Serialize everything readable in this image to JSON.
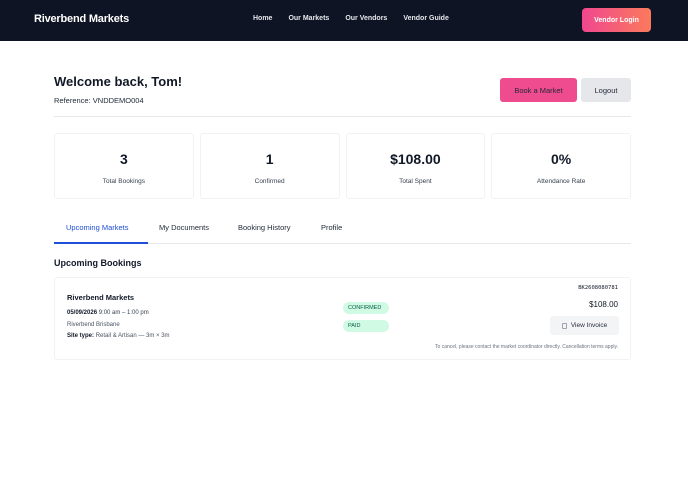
{
  "nav": {
    "brand": "Riverbend Markets",
    "links": [
      "Home",
      "Our Markets",
      "Our Vendors",
      "Vendor Guide"
    ],
    "cta": "Vendor Login"
  },
  "header": {
    "welcome": "Welcome back, Tom!",
    "reference": "Reference: VNDDEMO004",
    "book_label": "Book a Market",
    "logout_label": "Logout"
  },
  "stats": [
    {
      "value": "3",
      "label": "Total Bookings"
    },
    {
      "value": "1",
      "label": "Confirmed"
    },
    {
      "value": "$108.00",
      "label": "Total Spent"
    },
    {
      "value": "0%",
      "label": "Attendance Rate"
    }
  ],
  "tabs": [
    "Upcoming Markets",
    "My Documents",
    "Booking History",
    "Profile"
  ],
  "active_tab": "Upcoming Markets",
  "section_title": "Upcoming Bookings",
  "booking": {
    "market": "Riverbend Markets",
    "date": "05/09/2026",
    "time": "9:00 am – 1:00 pm",
    "location": "Riverbend Brisbane",
    "site_type_label": "Site type:",
    "site_type_value": "Retail & Artisan — 3m × 3m",
    "status_confirmed": "CONFIRMED",
    "status_paid": "PAID",
    "ref": "BK2608080781",
    "amount": "$108.00",
    "invoice_label": "View Invoice",
    "note": "To cancel, please contact the market coordinator directly. Cancellation terms apply."
  },
  "colors": {
    "nav_bg": "#0f1424",
    "accent_pink": "#ef4b8f",
    "accent_orange": "#fb7a5c",
    "active_tab": "#1d4ed8",
    "badge_bg": "#d1fae5"
  }
}
